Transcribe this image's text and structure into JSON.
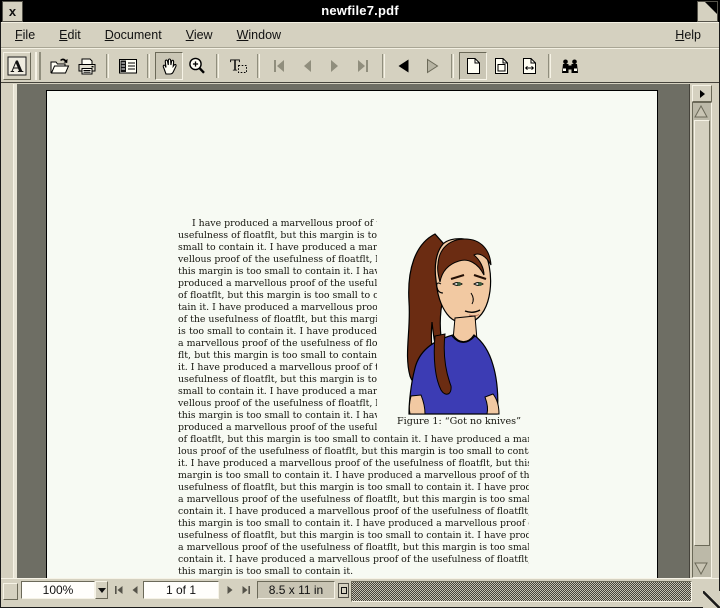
{
  "window": {
    "title": "newfile7.pdf"
  },
  "menubar": {
    "items": [
      "File",
      "Edit",
      "Document",
      "View",
      "Window"
    ],
    "help": "Help"
  },
  "toolbar": {
    "icons": [
      "acrobat-logo",
      "open",
      "print",
      "navigation-pane",
      "hand-tool",
      "zoom-tool",
      "text-select-tool",
      "first-page",
      "previous-page",
      "next-page",
      "last-page",
      "go-back",
      "go-forward",
      "actual-size",
      "fit-page",
      "fit-width",
      "find"
    ],
    "selected_tools": [
      "hand-tool",
      "actual-size"
    ]
  },
  "document": {
    "narrow_lines": [
      "I have produced a marvellous proof of the",
      "usefulness of floatflt, but this margin is too",
      "small to contain it.  I have produced a mar-",
      "vellous proof of the usefulness of floatflt, but",
      "this margin is too small to contain it. I have",
      "produced a marvellous proof of the usefulness",
      "of floatflt, but this margin is too small to con-",
      "tain it.  I have produced a marvellous proof",
      "of the usefulness of floatflt, but this margin",
      "is too small to contain it.  I have produced",
      "a marvellous proof of the usefulness of float-",
      "flt, but this margin is too small to contain",
      "it. I have produced a marvellous proof of the",
      "usefulness of floatflt, but this margin is too",
      "small to contain it.  I have produced a mar-",
      "vellous proof of the usefulness of floatflt, but",
      "this margin is too small to contain it. I have",
      "produced a marvellous proof of the usefulness"
    ],
    "wide_lines": [
      "of floatflt, but this margin is too small to contain it. I have produced a marvel-",
      "lous proof of the usefulness of floatflt, but this margin is too small to contain",
      "it.  I have produced a marvellous proof of the usefulness of floatflt, but this",
      "margin is too small to contain it.  I have produced a marvellous proof of the",
      "usefulness of floatflt, but this margin is too small to contain it. I have produced",
      "a marvellous proof of the usefulness of floatflt, but this margin is too small to",
      "contain it. I have produced a marvellous proof of the usefulness of floatflt, but",
      "this margin is too small to contain it. I have produced a marvellous proof of the",
      "usefulness of floatflt, but this margin is too small to contain it. I have produced",
      "a marvellous proof of the usefulness of floatflt, but this margin is too small to",
      "contain it. I have produced a marvellous proof of the usefulness of floatflt, but",
      "this margin is too small to contain it."
    ],
    "figure": {
      "caption": "Figure 1:  “Got no knives”"
    }
  },
  "statusbar": {
    "zoom_level": "100%",
    "page_indicator": "1 of 1",
    "page_size": "8.5 x 11 in",
    "icons": [
      "zoom-dropdown",
      "first-page",
      "previous-page",
      "next-page",
      "last-page",
      "page-size"
    ]
  },
  "titlebar": {
    "close_glyph": "x"
  },
  "colors": {
    "chrome": "#d5d1c0",
    "titlebar": "#000000",
    "canvas": "#6e6e64",
    "page": "#f7faf3",
    "shirt_blue": "#3c3cb4",
    "hair_brown": "#6b2c12",
    "skin": "#f2c9a2"
  }
}
